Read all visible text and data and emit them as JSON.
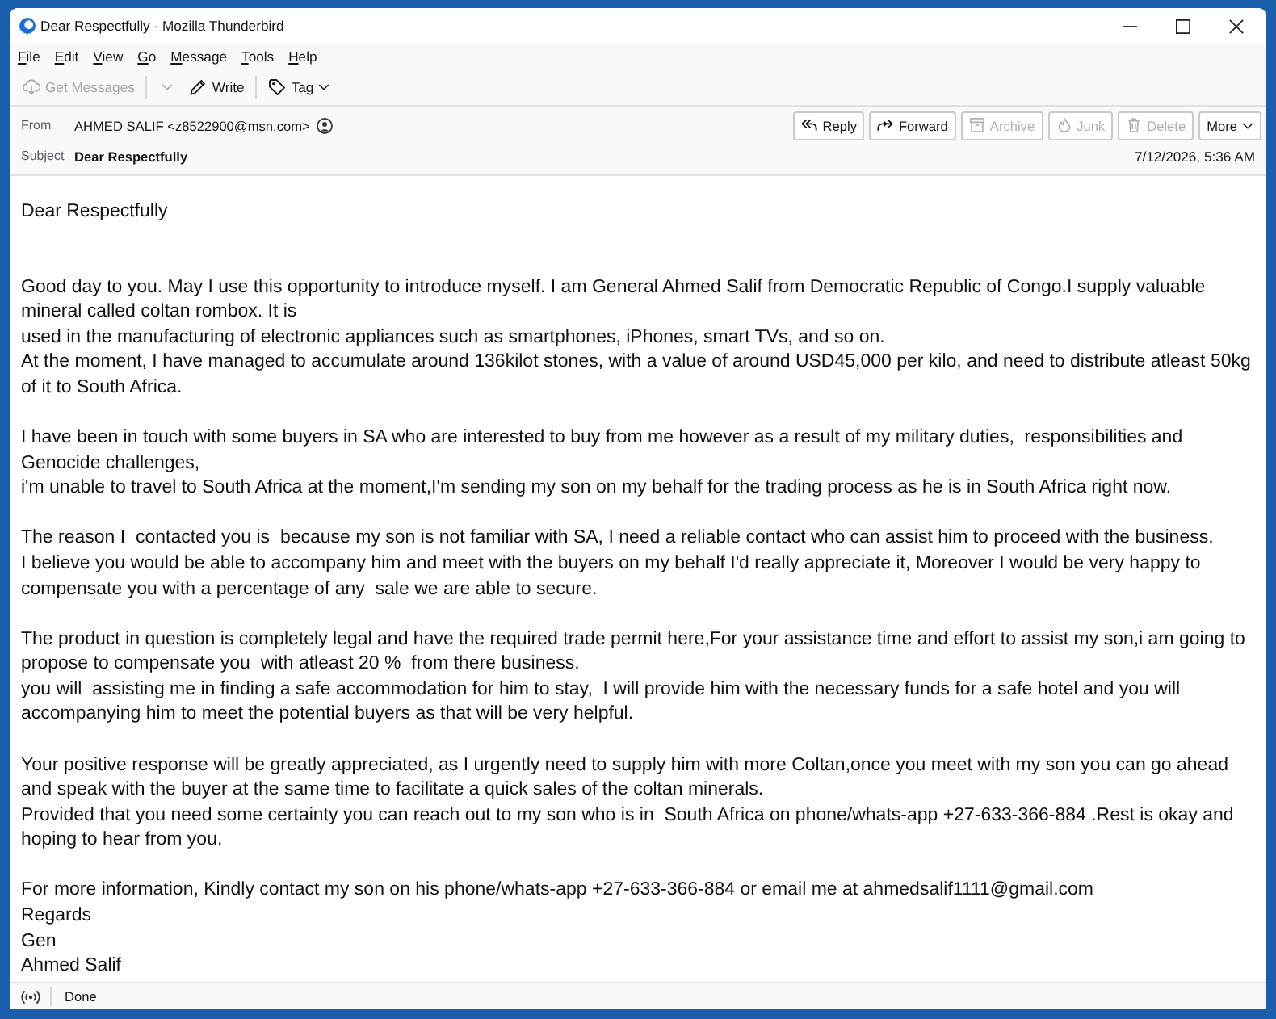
{
  "window": {
    "title": "Dear Respectfully - Mozilla Thunderbird"
  },
  "menu_bar": [
    "File",
    "Edit",
    "View",
    "Go",
    "Message",
    "Tools",
    "Help"
  ],
  "toolbar": {
    "get_messages": {
      "label": "Get Messages",
      "disabled": true
    },
    "write": {
      "label": "Write",
      "disabled": false
    },
    "tag": {
      "label": "Tag",
      "disabled": false
    }
  },
  "message_header": {
    "from_label": "From",
    "from": "AHMED SALIF <z8522900@msn.com>",
    "subject_label": "Subject",
    "subject": "Dear Respectfully",
    "date": "7/12/2026, 5:36 AM",
    "actions": [
      {
        "kind": "reply",
        "label": "Reply",
        "disabled": false
      },
      {
        "kind": "forward",
        "label": "Forward",
        "disabled": false
      },
      {
        "kind": "archive",
        "label": "Archive",
        "disabled": true
      },
      {
        "kind": "junk",
        "label": "Junk",
        "disabled": true
      },
      {
        "kind": "delete",
        "label": "Delete",
        "disabled": true
      },
      {
        "kind": "more",
        "label": "More",
        "disabled": false
      }
    ]
  },
  "body": {
    "greeting": "Dear Respectfully",
    "paragraphs": [
      {
        "lines": [
          "Good day to you. May I use this opportunity to introduce myself. I am General Ahmed Salif from Democratic Republic of Congo.I supply valuable",
          "mineral called coltan rombox. It is",
          "used in the manufacturing of electronic appliances such as smartphones, iPhones, smart TVs, and so on.",
          "At the moment, I have managed to accumulate around 136kilot stones, with a value of around USD45,000 per kilo, and need to distribute atleast 50kg",
          "of it to South Africa."
        ]
      },
      {
        "lines": [
          "I have been in touch with some buyers in SA who are interested to buy from me however as a result of my military duties,  responsibilities and",
          "Genocide challenges,",
          "i'm unable to travel to South Africa at the moment,I'm sending my son on my behalf for the trading process as he is in South Africa right now."
        ]
      },
      {
        "lines": [
          "The reason I  contacted you is  because my son is not familiar with SA, I need a reliable contact who can assist him to proceed with the business.",
          "I believe you would be able to accompany him and meet with the buyers on my behalf I'd really appreciate it, Moreover I would be very happy to",
          "compensate you with a percentage of any  sale we are able to secure."
        ]
      },
      {
        "lines": [
          "The product in question is completely legal and have the required trade permit here,For your assistance time and effort to assist my son,i am going to",
          "propose to compensate you  with atleast 20 %  from there business.",
          "you will  assisting me in finding a safe accommodation for him to stay,  I will provide him with the necessary funds for a safe hotel and you will",
          "accompanying him to meet the potential buyers as that will be very helpful."
        ]
      },
      {
        "lines": [
          "Your positive response will be greatly appreciated, as I urgently need to supply him with more Coltan,once you meet with my son you can go ahead",
          "and speak with the buyer at the same time to facilitate a quick sales of the coltan minerals.",
          "Provided that you need some certainty you can reach out to my son who is in  South Africa on phone/whats-app +27-633-366-884 .Rest is okay and",
          "hoping to hear from you."
        ]
      },
      {
        "lines": [
          "For more information, Kindly contact my son on his phone/whats-app +27-633-366-884 or email me at ahmedsalif1111@gmail.com",
          "Regards",
          "Gen",
          "Ahmed Salif"
        ]
      }
    ]
  },
  "status_bar": {
    "text": "Done"
  }
}
